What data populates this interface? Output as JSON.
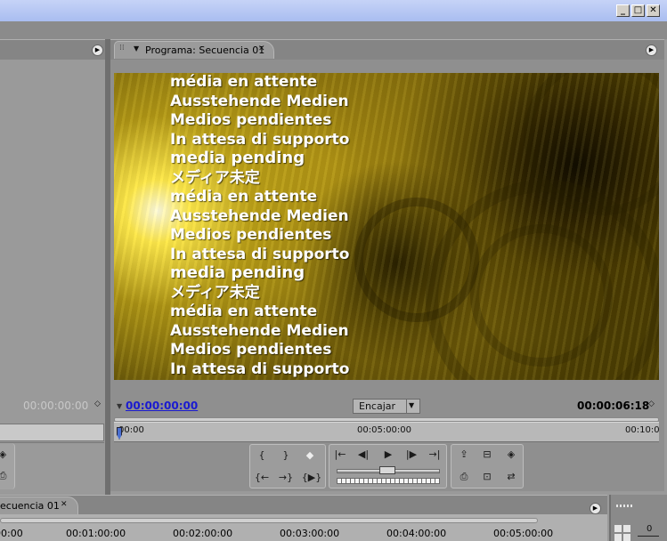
{
  "window": {
    "minimize": "_",
    "maximize": "□",
    "close": "✕"
  },
  "program_monitor": {
    "tab_label": "Programa: Secuencia 01",
    "close_glyph": "✕",
    "menu_glyph": "▼",
    "video_lines": [
      "média en attente",
      "Ausstehende Medien",
      "Medios pendientes",
      "In attesa di supporto",
      "media pending",
      "メディア未定",
      "média en attente",
      "Ausstehende Medien",
      "Medios pendientes",
      "In attesa di supporto",
      "media pending",
      "メディア未定",
      "média en attente",
      "Ausstehende Medien",
      "Medios pendientes",
      "In attesa di supporto"
    ],
    "current_timecode": "00:00:00:00",
    "fit_select": "Encajar",
    "duration_timecode": "00:00:06:18",
    "ruler_labels": [
      "00:00",
      "00:05:00:00",
      "00:10:0"
    ],
    "playhead_fraction": 0.0,
    "controls": {
      "mark_in": "{",
      "mark_out": "}",
      "set_marker": "◆",
      "goto_in": "{←",
      "goto_out": "→}",
      "play_in_to_out": "{▶}",
      "step_to_previous": "|←",
      "step_back": "◀|",
      "play": "▶",
      "step_forward": "|▶",
      "step_to_next": "→|",
      "lift": "⇪",
      "extract": "⊟",
      "trim": "◈",
      "export_frame": "⎙",
      "safe_margins": "⊡",
      "output": "⇄"
    }
  },
  "source_monitor": {
    "timecode": "00:00:00:00",
    "tc_arrows": "◇",
    "ruler_label": "00:00"
  },
  "timeline": {
    "tab_label": "ecuencia 01",
    "close_glyph": "✕",
    "ticks": [
      "00:00",
      "00:01:00:00",
      "00:02:00:00",
      "00:03:00:00",
      "00:04:00:00",
      "00:05:00:00"
    ],
    "right_label": "0"
  },
  "colors": {
    "accent_timecode": "#1a1ad0",
    "panel_bg": "#8f8f8f",
    "video_gold": "#a98c13"
  }
}
